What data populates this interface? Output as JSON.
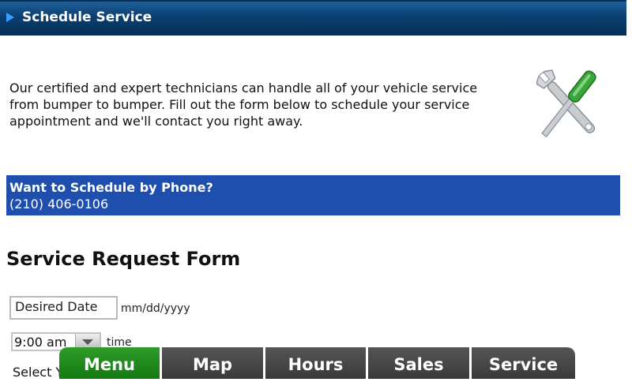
{
  "header": {
    "title": "Schedule Service"
  },
  "intro": {
    "text": "Our certified and expert technicians can handle all of your vehicle service from bumper to bumper. Fill out the form below to schedule your service appointment and we'll contact you right away."
  },
  "phone": {
    "heading": "Want to Schedule by Phone?",
    "number": "(210) 406-0106"
  },
  "form": {
    "title": "Service Request Form",
    "date_field": {
      "value": "Desired Date",
      "hint": "mm/dd/yyyy"
    },
    "time_field": {
      "selected": "9:00 am",
      "label": "time"
    },
    "partial_label": "Select Y"
  },
  "nav": {
    "tabs": [
      "Menu",
      "Map",
      "Hours",
      "Sales",
      "Service"
    ],
    "active": "Menu"
  },
  "colors": {
    "header": "#0b3f70",
    "phone_box": "#1f4fae",
    "nav_active": "#1f8c1c",
    "nav_inactive": "#454545"
  },
  "icons": {
    "tools": "wrench-screwdriver-icon",
    "header_arrow": "play-arrow-icon"
  }
}
